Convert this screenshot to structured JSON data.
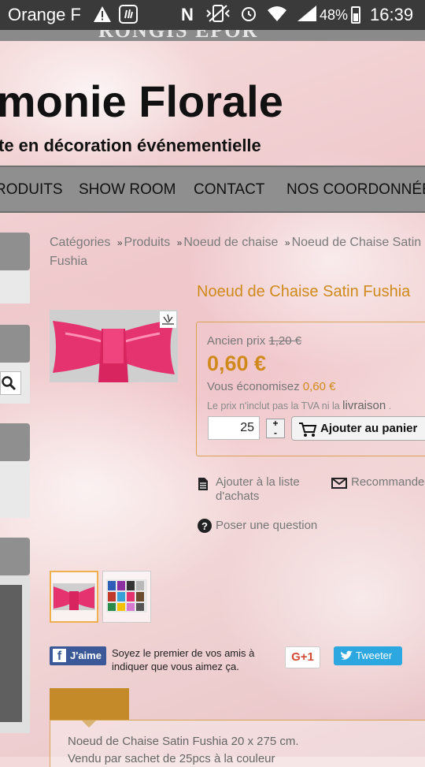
{
  "status_bar": {
    "carrier": "Orange F",
    "battery_percent": "48%",
    "time": "16:39",
    "icons": [
      "warning-icon",
      "ok-gesture-icon",
      "nfc-icon",
      "vibrate-icon",
      "alarm-icon",
      "wifi-icon",
      "signal-icon",
      "battery-icon"
    ]
  },
  "banner_strip_text": "RONGIS          EPOR",
  "site": {
    "title": "rmonie Florale",
    "tagline": "te en décoration événementielle"
  },
  "nav": {
    "items": [
      "RODUITS",
      "SHOW ROOM",
      "CONTACT",
      "NOS COORDONNÉE"
    ]
  },
  "breadcrumb": {
    "items": [
      "Catégories",
      "Produits",
      "Noeud de chaise",
      "Noeud de Chaise Satin Fushia"
    ],
    "separator": "»"
  },
  "product": {
    "title": "Noeud de Chaise Satin Fushia",
    "old_price_label": "Ancien prix",
    "old_price": "1,20 €",
    "price": "0,60 €",
    "savings_label": "Vous économisez",
    "savings_amount": "0,60 €",
    "tax_note_prefix": "Le prix n'inclut pas la TVA ni la",
    "tax_note_link": "livraison",
    "tax_note_suffix": ".",
    "quantity": "25",
    "stepper_plus": "+",
    "stepper_minus": "-",
    "add_to_cart": "Ajouter au panier",
    "wishlist": "Ajouter à la liste d'achats",
    "recommend": "Recommande",
    "ask_question": "Poser une question"
  },
  "social": {
    "fb_label": "J'aime",
    "fb_text": "Soyez le premier de vos amis à indiquer que vous aimez ça.",
    "gplus_label": "G+1",
    "tweet_label": "Tweeter"
  },
  "description": {
    "line1": "Noeud de Chaise Satin Fushia 20 x 275 cm.",
    "line2": "Vendu par sachet de 25pcs à la couleur"
  },
  "colors": {
    "accent": "#d08a1c",
    "nav_bg": "#8f8f8f",
    "fushia": "#e5336f"
  }
}
